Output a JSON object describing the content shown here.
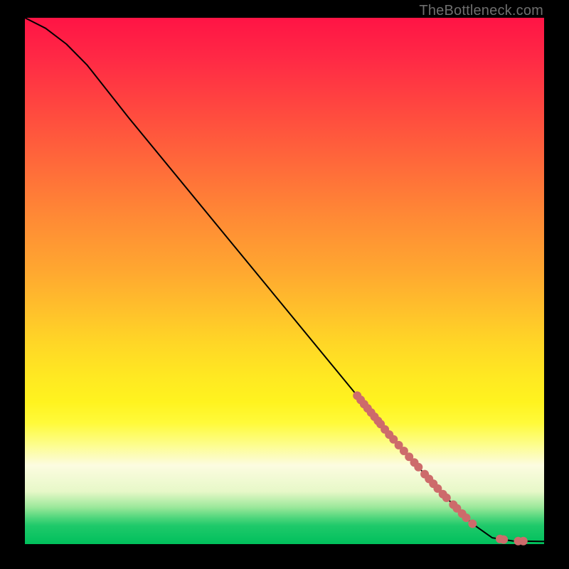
{
  "watermark": "TheBottleneck.com",
  "colors": {
    "page_bg": "#000000",
    "dot": "#cd6b6b",
    "curve": "#000000"
  },
  "chart_data": {
    "type": "line",
    "title": "",
    "xlabel": "",
    "ylabel": "",
    "xlim": [
      0,
      100
    ],
    "ylim": [
      0,
      100
    ],
    "curve": [
      {
        "x": 0,
        "y": 100
      },
      {
        "x": 4,
        "y": 98
      },
      {
        "x": 8,
        "y": 95
      },
      {
        "x": 12,
        "y": 91
      },
      {
        "x": 20,
        "y": 81
      },
      {
        "x": 30,
        "y": 69
      },
      {
        "x": 40,
        "y": 57
      },
      {
        "x": 50,
        "y": 45
      },
      {
        "x": 60,
        "y": 33
      },
      {
        "x": 70,
        "y": 21
      },
      {
        "x": 80,
        "y": 10
      },
      {
        "x": 86,
        "y": 4
      },
      {
        "x": 90,
        "y": 1.2
      },
      {
        "x": 94,
        "y": 0.6
      },
      {
        "x": 100,
        "y": 0.5
      }
    ],
    "dot_clusters": [
      {
        "x_start": 64,
        "x_end": 68,
        "count": 7
      },
      {
        "x_start": 68.5,
        "x_end": 71,
        "count": 4
      },
      {
        "x_start": 72,
        "x_end": 74,
        "count": 3
      },
      {
        "x_start": 75,
        "x_end": 75.8,
        "count": 2
      },
      {
        "x_start": 77,
        "x_end": 79.5,
        "count": 4
      },
      {
        "x_start": 80.5,
        "x_end": 81.2,
        "count": 2
      },
      {
        "x_start": 82.5,
        "x_end": 83.2,
        "count": 2
      },
      {
        "x_start": 84.2,
        "x_end": 85,
        "count": 2
      },
      {
        "x_start": 86,
        "x_end": 86.4,
        "count": 1
      },
      {
        "x_start": 91.5,
        "x_end": 92.2,
        "count": 2
      },
      {
        "x_start": 95,
        "x_end": 96,
        "count": 2
      }
    ],
    "dot_radius": 6
  }
}
